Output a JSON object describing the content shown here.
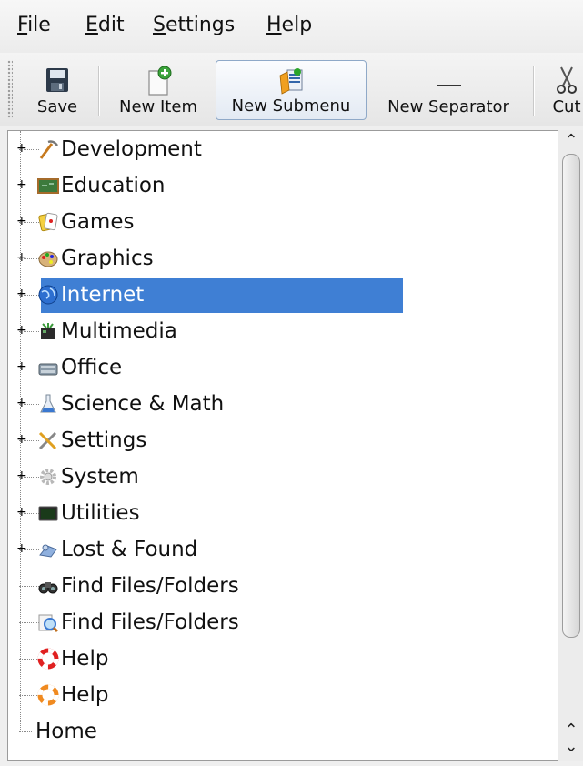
{
  "menubar": {
    "items": [
      {
        "underline": "F",
        "rest": "ile"
      },
      {
        "underline": "E",
        "rest": "dit"
      },
      {
        "underline": "S",
        "rest": "ettings"
      },
      {
        "underline": "H",
        "rest": "elp"
      }
    ]
  },
  "toolbar": {
    "save_label": "Save",
    "new_item_label": "New Item",
    "new_submenu_label": "New Submenu",
    "new_separator_label": "New Separator",
    "cut_label": "Cut"
  },
  "tree": {
    "items": [
      {
        "label": "Development",
        "icon": "development-icon",
        "expandable": true
      },
      {
        "label": "Education",
        "icon": "education-icon",
        "expandable": true
      },
      {
        "label": "Games",
        "icon": "games-icon",
        "expandable": true
      },
      {
        "label": "Graphics",
        "icon": "graphics-icon",
        "expandable": true
      },
      {
        "label": "Internet",
        "icon": "internet-globe-icon",
        "expandable": true,
        "selected": true
      },
      {
        "label": "Multimedia",
        "icon": "multimedia-icon",
        "expandable": true
      },
      {
        "label": "Office",
        "icon": "office-icon",
        "expandable": true
      },
      {
        "label": "Science & Math",
        "icon": "science-flask-icon",
        "expandable": true
      },
      {
        "label": "Settings",
        "icon": "settings-tools-icon",
        "expandable": true
      },
      {
        "label": "System",
        "icon": "system-gear-icon",
        "expandable": true
      },
      {
        "label": "Utilities",
        "icon": "utilities-icon",
        "expandable": true
      },
      {
        "label": "Lost & Found",
        "icon": "lost-found-icon",
        "expandable": true
      },
      {
        "label": "Find Files/Folders",
        "icon": "binoculars-icon",
        "expandable": false
      },
      {
        "label": "Find Files/Folders",
        "icon": "magnifier-icon",
        "expandable": false
      },
      {
        "label": "Help",
        "icon": "lifebuoy-icon",
        "expandable": false
      },
      {
        "label": "Help",
        "icon": "lifebuoy-orange-icon",
        "expandable": false
      },
      {
        "label": "Home",
        "icon": "",
        "expandable": false
      }
    ]
  },
  "colors": {
    "selection": "#3f7fd4"
  }
}
